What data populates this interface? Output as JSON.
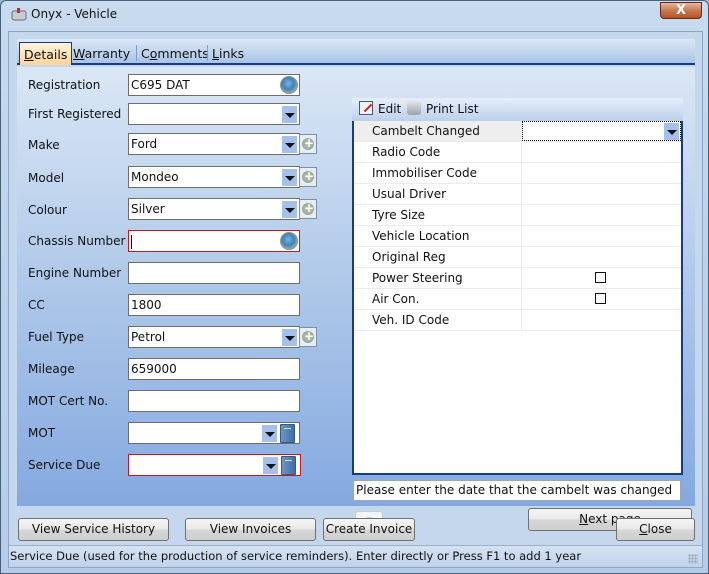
{
  "window": {
    "title": "Onyx - Vehicle",
    "close_glyph": "X"
  },
  "tabs": [
    {
      "label": "Details",
      "accel": "D",
      "rest": "etails",
      "active": true
    },
    {
      "label": "Warranty",
      "accel": "W",
      "rest": "arranty",
      "active": false
    },
    {
      "label": "Comments",
      "pre": "C",
      "accel": "o",
      "rest": "mments",
      "active": false
    },
    {
      "label": "Links",
      "accel": "L",
      "rest": "inks",
      "active": false
    }
  ],
  "form": {
    "registration": {
      "label": "Registration",
      "value": "C695 DAT"
    },
    "first_registered": {
      "label": "First Registered",
      "value": ""
    },
    "make": {
      "label": "Make",
      "value": "Ford"
    },
    "model": {
      "label": "Model",
      "value": "Mondeo"
    },
    "colour": {
      "label": "Colour",
      "value": "Silver"
    },
    "chassis_number": {
      "label": "Chassis Number",
      "value": ""
    },
    "engine_number": {
      "label": "Engine Number",
      "value": ""
    },
    "cc": {
      "label": "CC",
      "value": "1800"
    },
    "fuel_type": {
      "label": "Fuel Type",
      "value": "Petrol"
    },
    "mileage": {
      "label": "Mileage",
      "value": "659000"
    },
    "mot_cert_no": {
      "label": "MOT Cert No.",
      "value": ""
    },
    "mot": {
      "label": "MOT",
      "value": ""
    },
    "service_due": {
      "label": "Service Due",
      "value": ""
    }
  },
  "grid_toolbar": {
    "edit_label": "Edit",
    "print_label": "Print List"
  },
  "grid_rows": [
    {
      "name": "Cambelt Changed",
      "value": "",
      "type": "dropdown",
      "selected": true
    },
    {
      "name": "Radio Code",
      "value": "",
      "type": "text"
    },
    {
      "name": "Immobiliser Code",
      "value": "",
      "type": "text"
    },
    {
      "name": "Usual Driver",
      "value": "",
      "type": "text"
    },
    {
      "name": "Tyre Size",
      "value": "",
      "type": "text"
    },
    {
      "name": "Vehicle Location",
      "value": "",
      "type": "text"
    },
    {
      "name": "Original Reg",
      "value": "",
      "type": "text"
    },
    {
      "name": "Power Steering",
      "checked": false,
      "type": "checkbox"
    },
    {
      "name": "Air Con.",
      "checked": false,
      "type": "checkbox"
    },
    {
      "name": "Veh. ID Code",
      "value": "",
      "type": "text"
    }
  ],
  "hint_text": "Please enter the date that the cambelt was changed",
  "buttons": {
    "next_page": {
      "accel": "N",
      "rest": "ext page"
    },
    "view_service_history": "View Service History",
    "view_invoices": "View Invoices",
    "create_invoice": "Create Invoice",
    "close": {
      "accel": "C",
      "rest": "lose"
    }
  },
  "status_text": "Service Due (used for the production of service reminders).  Enter directly or Press F1 to add 1 year",
  "colors": {
    "tab_accent": "#173a8a",
    "error_border": "#c41a1a"
  }
}
